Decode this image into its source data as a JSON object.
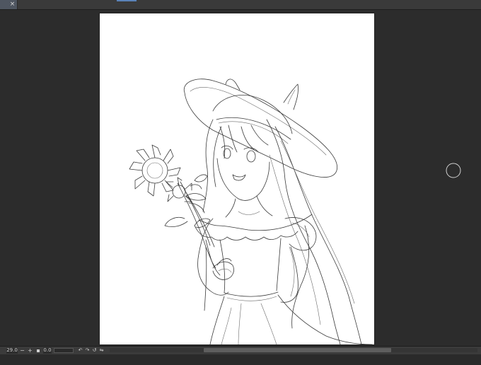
{
  "tabs": [
    {
      "close_glyph": "×"
    }
  ],
  "status": {
    "zoom": "29.0",
    "zoom_out": "−",
    "zoom_in": "+",
    "angle": "0.0",
    "rotate_left": "↶",
    "rotate_right": "↷",
    "reset_rotation": "↺",
    "flip": "⇋"
  },
  "colors": {
    "workspace": "#2c2c2c",
    "canvas": "#ffffff",
    "line_art": "#3a3a3a",
    "tab_active": "#4f5661",
    "accent": "#5a82b8"
  },
  "icons": {
    "brush_cursor": "circle-brush-cursor-icon",
    "tab_close": "close-icon",
    "fit_view": "fit-square-icon"
  }
}
